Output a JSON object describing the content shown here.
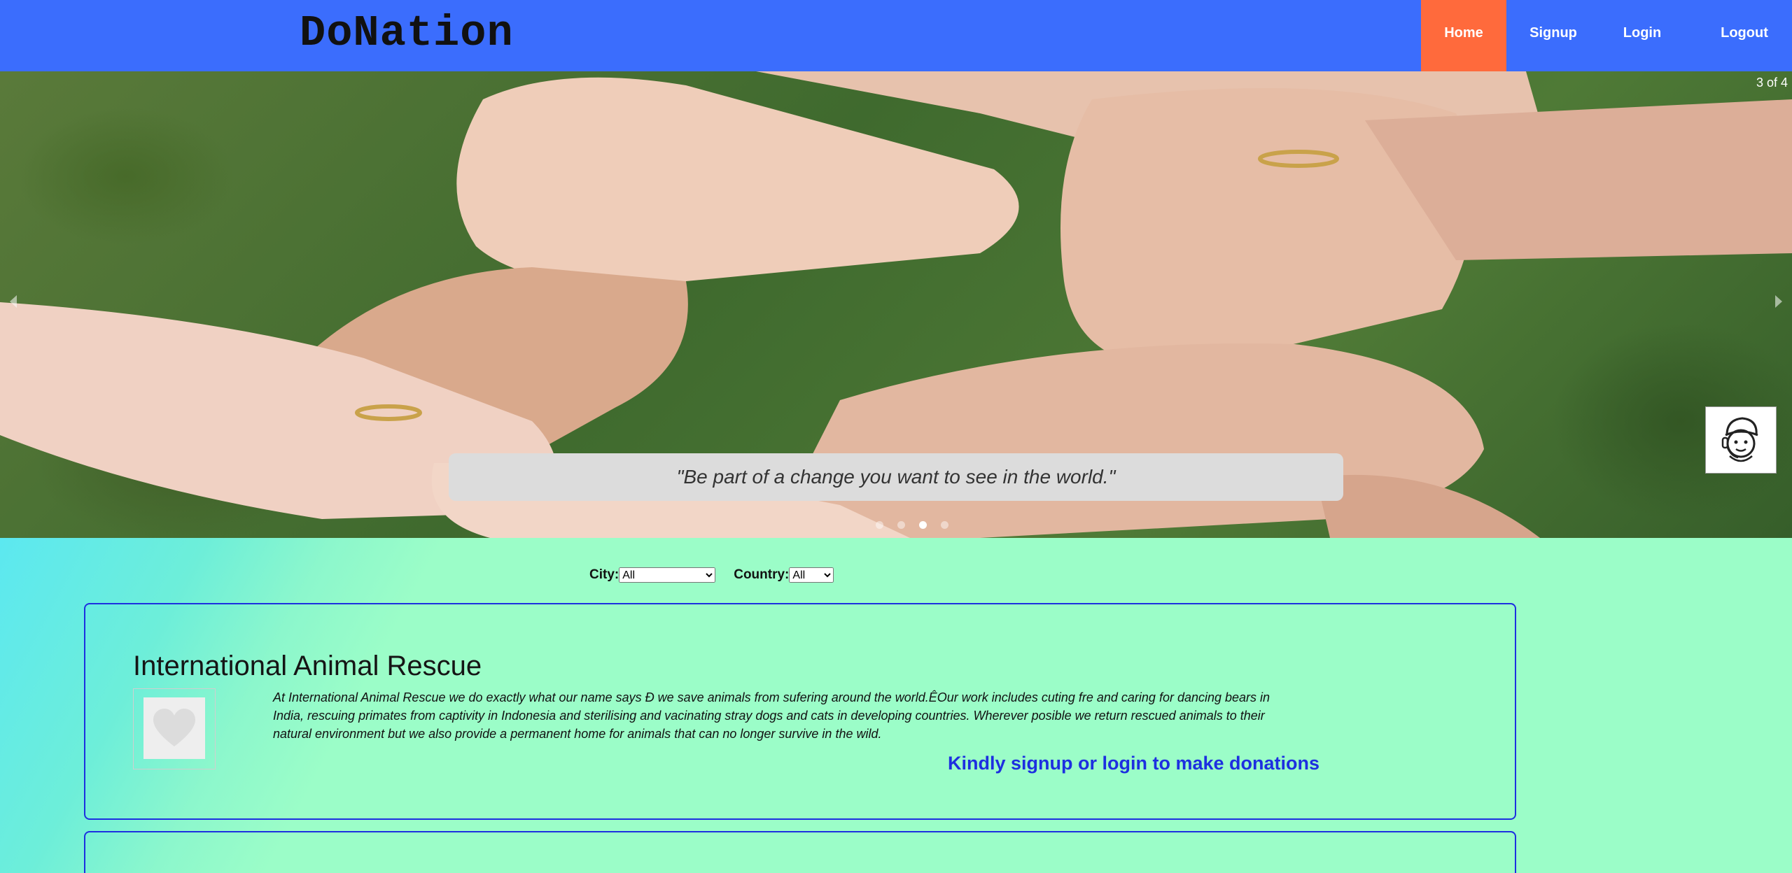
{
  "navbar": {
    "brand": "DoNation",
    "items": [
      {
        "label": "Home",
        "active": true
      },
      {
        "label": "Signup"
      },
      {
        "label": "Login"
      },
      {
        "label": "Logout"
      }
    ],
    "bg_color": "#3b6dfd",
    "active_color": "#ff6a3c"
  },
  "carousel": {
    "counter": "3 of 4",
    "caption": "\"Be part of a change you want to see in the world.\"",
    "total_slides": 4,
    "active_slide": 3,
    "prev_icon": "chevron-left-icon",
    "next_icon": "chevron-right-icon"
  },
  "assistant": {
    "icon": "chatbot-avatar-icon"
  },
  "filters": {
    "city_label": "City:",
    "city_value": "All",
    "country_label": "Country:",
    "country_value": "All"
  },
  "organizations": [
    {
      "name": "International Animal Rescue",
      "image_icon": "heart-icon",
      "description": "At International Animal Rescue we do exactly what our name says Ð we save animals from sufering around the world.ÊOur work includes cuting fre and caring for dancing bears in India, rescuing primates from captivity in Indonesia and sterilising and vacinating stray dogs and cats in developing countries. Wherever posible we return rescued animals to their natural environment but we also provide a permanent home for animals that can no longer survive in the wild.",
      "note": "Kindly signup or login to make donations"
    }
  ]
}
